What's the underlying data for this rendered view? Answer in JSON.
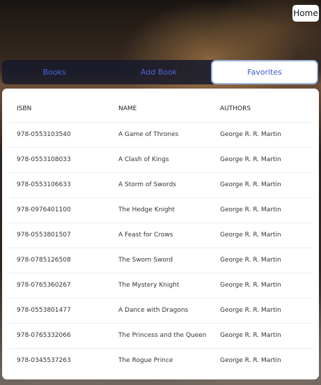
{
  "header": {
    "home_label": "Home"
  },
  "tabs": [
    {
      "label": "Books",
      "active": false
    },
    {
      "label": "Add Book",
      "active": false
    },
    {
      "label": "Favorites",
      "active": true
    }
  ],
  "table": {
    "columns": [
      "ISBN",
      "NAME",
      "AUTHORS"
    ],
    "rows": [
      [
        "978-0553103540",
        "A Game of Thrones",
        "George R. R. Martin"
      ],
      [
        "978-0553108033",
        "A Clash of Kings",
        "George R. R. Martin"
      ],
      [
        "978-0553106633",
        "A Storm of Swords",
        "George R. R. Martin"
      ],
      [
        "978-0976401100",
        "The Hedge Knight",
        "George R. R. Martin"
      ],
      [
        "978-0553801507",
        "A Feast for Crows",
        "George R. R. Martin"
      ],
      [
        "978-0785126508",
        "The Sworn Sword",
        "George R. R. Martin"
      ],
      [
        "978-0765360267",
        "The Mystery Knight",
        "George R. R. Martin"
      ],
      [
        "978-0553801477",
        "A Dance with Dragons",
        "George R. R. Martin"
      ],
      [
        "978-0765332066",
        "The Princess and the Queen",
        "George R. R. Martin"
      ],
      [
        "978-0345537263",
        "The Rogue Prince",
        "George R. R. Martin"
      ]
    ]
  },
  "colors": {
    "tab_text": "#4b63d8",
    "active_tab_border": "#9db3dc"
  }
}
